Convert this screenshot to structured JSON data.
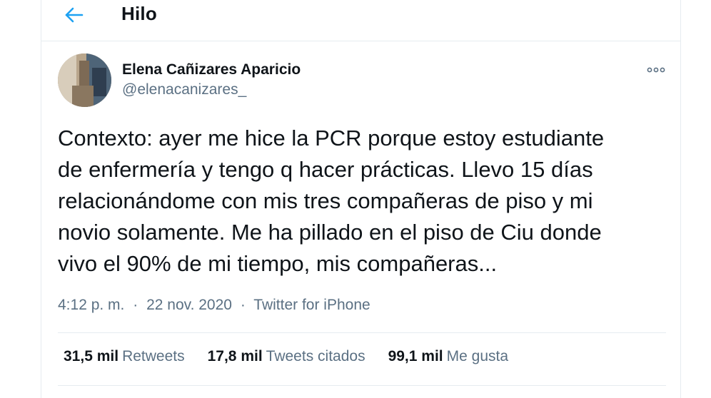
{
  "header": {
    "title": "Hilo",
    "back_icon": "arrow-left-icon",
    "accent_color": "#1da1f2"
  },
  "tweet": {
    "author_name": "Elena Cañizares Aparicio",
    "author_handle": "@elenacanizares_",
    "more_icon": "more-options-icon",
    "text": "Contexto: ayer me hice la PCR porque estoy estudiante\nde enfermería y tengo q hacer prácticas. Llevo 15 días\nrelacionándome con mis tres compañeras de piso y mi\nnovio solamente. Me ha pillado en el piso de Ciu donde\nvivo el 90% de mi tiempo, mis compañeras...",
    "time": "4:12 p. m.",
    "date": "22 nov. 2020",
    "separator": "·",
    "source": "Twitter for iPhone"
  },
  "stats": [
    {
      "count": "31,5 mil",
      "label": "Retweets"
    },
    {
      "count": "17,8 mil",
      "label": "Tweets citados"
    },
    {
      "count": "99,1 mil",
      "label": "Me gusta"
    }
  ]
}
